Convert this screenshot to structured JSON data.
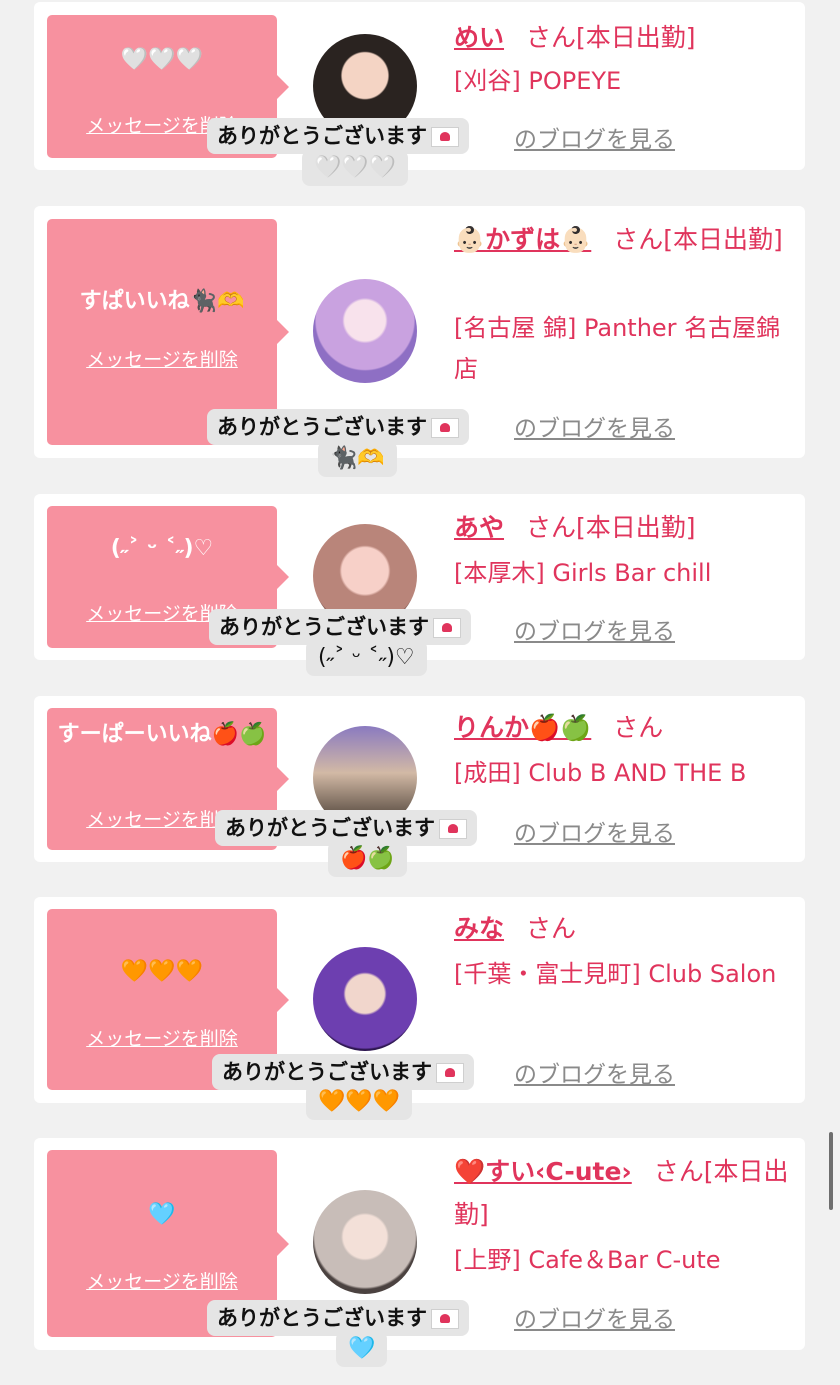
{
  "delete_label": "メッセージを削除",
  "blog_label": "のブログを見る",
  "reply_text": "ありがとうございます",
  "accent_color": "#e0345c",
  "bubble_color": "#f7919f",
  "cards": [
    {
      "message": "🤍🤍🤍",
      "name": "めい",
      "suffix": "さん[本日出勤]",
      "shop": "[刈谷] POPEYE",
      "reply_emoji": "🤍🤍🤍"
    },
    {
      "message": "すぱいいね🐈‍⬛🫶",
      "name": "👶🏻かずは👶🏻",
      "suffix": "さん[本日出勤]",
      "shop": "[名古屋 錦] Panther 名古屋錦店",
      "reply_emoji": "🐈‍⬛🫶"
    },
    {
      "message": "(˶˃ ᵕ ˂˶)♡",
      "name": "あや",
      "suffix": "さん[本日出勤]",
      "shop": "[本厚木] Girls Bar chill",
      "reply_emoji": "(˶˃ ᵕ ˂˶)♡"
    },
    {
      "message": "すーぱーいいね🍎🍏",
      "name": "りんか🍎🍏",
      "suffix": "さん",
      "shop": "[成田] Club B AND THE B",
      "reply_emoji": "🍎🍏"
    },
    {
      "message": "🧡🧡🧡",
      "name": "みな",
      "suffix": "さん",
      "shop": "[千葉・富士見町] Club Salon",
      "reply_emoji": "🧡🧡🧡"
    },
    {
      "message": "🩵",
      "name": "❤️すい‹C-ute›",
      "suffix": "さん[本日出勤]",
      "shop": "[上野] Cafe＆Bar C-ute",
      "reply_emoji": "🩵"
    }
  ]
}
